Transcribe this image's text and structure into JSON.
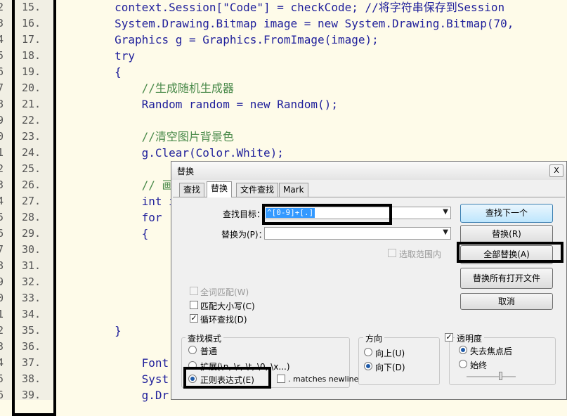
{
  "gutter": {
    "lines": [
      {
        "pre": "2",
        "num": "15."
      },
      {
        "pre": "3",
        "num": "16."
      },
      {
        "pre": "4",
        "num": "17."
      },
      {
        "pre": "5",
        "num": "18."
      },
      {
        "pre": "6",
        "num": "19."
      },
      {
        "pre": "7",
        "num": "20."
      },
      {
        "pre": "8",
        "num": "21."
      },
      {
        "pre": "9",
        "num": "22."
      },
      {
        "pre": "0",
        "num": "23."
      },
      {
        "pre": "1",
        "num": "24."
      },
      {
        "pre": "2",
        "num": "25."
      },
      {
        "pre": "3",
        "num": "26."
      },
      {
        "pre": "4",
        "num": "27."
      },
      {
        "pre": "5",
        "num": "28."
      },
      {
        "pre": "6",
        "num": "29."
      },
      {
        "pre": "7",
        "num": "30."
      },
      {
        "pre": "8",
        "num": "31."
      },
      {
        "pre": "9",
        "num": "32."
      },
      {
        "pre": "0",
        "num": "33."
      },
      {
        "pre": "1",
        "num": "34."
      },
      {
        "pre": "2",
        "num": "35."
      },
      {
        "pre": "3",
        "num": "36."
      },
      {
        "pre": "4",
        "num": "37."
      },
      {
        "pre": "5",
        "num": "38."
      },
      {
        "pre": "6",
        "num": "39."
      }
    ]
  },
  "code": {
    "lines": [
      "        context.Session[\"Code\"] = checkCode; //将字符串保存到Session",
      "        System.Drawing.Bitmap image = new System.Drawing.Bitmap(70,",
      "        Graphics g = Graphics.FromImage(image);",
      "        try",
      "        {",
      "            //生成随机生成器",
      "            Random random = new Random();",
      "",
      "            //清空图片背景色",
      "            g.Clear(Color.White);",
      "",
      "            // 画",
      "            int i",
      "            for",
      "            {",
      "",
      "",
      "",
      "",
      "",
      "        }",
      "",
      "            Font",
      "            Syst",
      "            g.Dr"
    ]
  },
  "dialog": {
    "title": "替换",
    "close_label": "X",
    "tabs": [
      "查找",
      "替换",
      "文件查找",
      "Mark"
    ],
    "find_label": "查找目标：",
    "find_value": "^[0-9]+[.]",
    "replace_label": "替换为(P)：",
    "replace_value": "",
    "in_selection_label": "选取范围内",
    "buttons": {
      "find_next": "查找下一个",
      "replace": "替换(R)",
      "replace_all": "全部替换(A)",
      "replace_all_open": "替换所有打开文件",
      "cancel": "取消"
    },
    "options": {
      "whole_word": "全词匹配(W)",
      "match_case": "匹配大小写(C)",
      "wrap_around": "循环查找(D)"
    },
    "search_mode": {
      "title": "查找模式",
      "normal": "普通",
      "extended": "扩展(\\n, \\r, \\t, \\0, \\x...)",
      "regex": "正则表达式(E)",
      "matches_newline": ". matches newline"
    },
    "direction": {
      "title": "方向",
      "up": "向上(U)",
      "down": "向下(D)"
    },
    "transparency": {
      "title": "透明度",
      "on_lose_focus": "失去焦点后",
      "always": "始终"
    }
  }
}
